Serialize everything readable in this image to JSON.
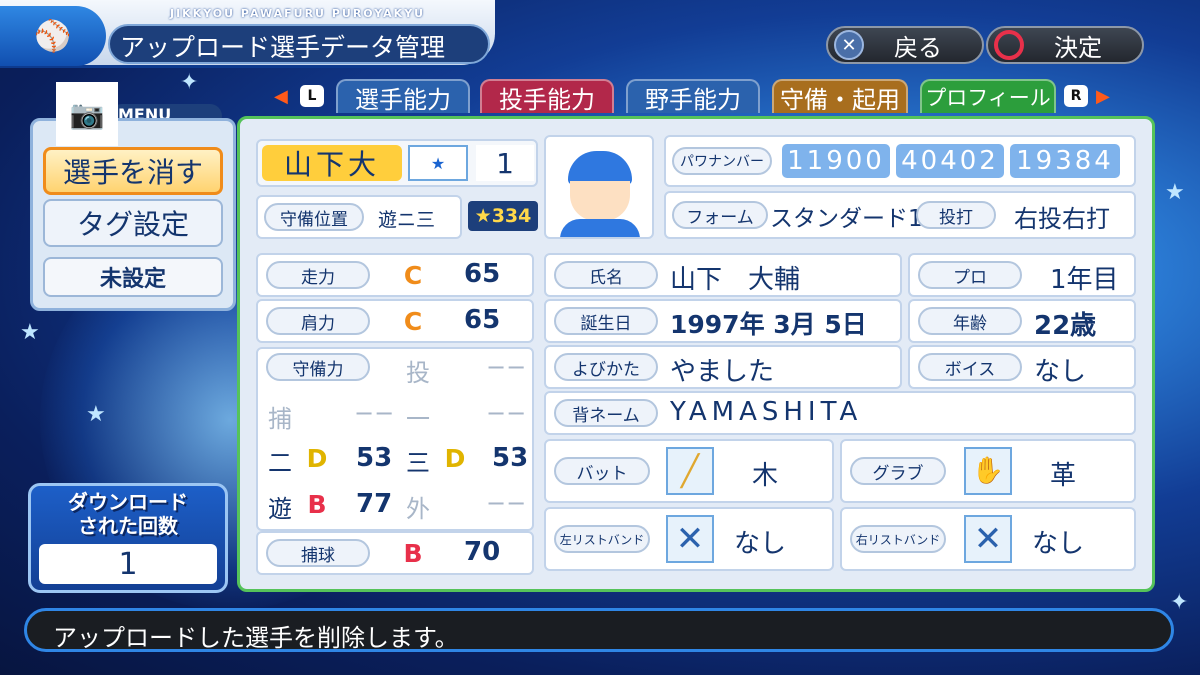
{
  "header": {
    "subtitle": "JIKKYOU PAWAFURU PUROYAKYU",
    "title": "アップロード選手データ管理",
    "back_label": "戻る",
    "confirm_label": "決定"
  },
  "tabs": {
    "left_key": "L",
    "right_key": "R",
    "items": [
      {
        "label": "選手能力",
        "color": "#2b62ad"
      },
      {
        "label": "投手能力",
        "color": "#b2284a"
      },
      {
        "label": "野手能力",
        "color": "#2b62ad"
      },
      {
        "label": "守備・起用",
        "color": "#a86e1e"
      },
      {
        "label": "プロフィール",
        "color": "#2c9e3c"
      }
    ]
  },
  "menu": {
    "tag": "MENU",
    "delete_label": "選手を消す",
    "tag_settings_label": "タグ設定",
    "tag_value": "未設定"
  },
  "download": {
    "label_line1": "ダウンロード",
    "label_line2": "された回数",
    "count": "1"
  },
  "player": {
    "name": "山下大",
    "number": "1",
    "position_label": "守備位置",
    "position_value": "遊ニ三",
    "star_value": "334",
    "pawa_label": "パワナンバー",
    "pawa_numbers": [
      "11900",
      "40402",
      "19384"
    ],
    "form_label": "フォーム",
    "form_value": "スタンダード1",
    "throw_bat_label": "投打",
    "throw_bat_value": "右投右打"
  },
  "abilities": {
    "speed": {
      "label": "走力",
      "grade": "C",
      "value": "65"
    },
    "arm": {
      "label": "肩力",
      "grade": "C",
      "value": "65"
    },
    "defense": {
      "label": "守備力",
      "pitcher": "投",
      "pitcher_value": "−−",
      "catcher": "捕",
      "catcher_value": "−−",
      "first": "一",
      "first_value": "−−",
      "second": "二",
      "second_grade": "D",
      "second_value": "53",
      "third": "三",
      "third_grade": "D",
      "third_value": "53",
      "short": "遊",
      "short_grade": "B",
      "short_value": "77",
      "outfield": "外",
      "outfield_value": "−−"
    },
    "catching": {
      "label": "捕球",
      "grade": "B",
      "value": "70"
    }
  },
  "profile": {
    "fullname_label": "氏名",
    "fullname": "山下　大輔",
    "pro_label": "プロ",
    "pro_value": "1年目",
    "birth_label": "誕生日",
    "birth_value": "1997年 3月 5日",
    "age_label": "年齢",
    "age_value": "22歳",
    "reading_label": "よびかた",
    "reading_value": "やました",
    "voice_label": "ボイス",
    "voice_value": "なし",
    "back_name_label": "背ネーム",
    "back_name_value": "YAMASHITA",
    "bat_label": "バット",
    "bat_value": "木",
    "glove_label": "グラブ",
    "glove_value": "革",
    "left_band_label": "左リストバンド",
    "left_band_value": "なし",
    "right_band_label": "右リストバンド",
    "right_band_value": "なし"
  },
  "message": "アップロードした選手を削除します。"
}
